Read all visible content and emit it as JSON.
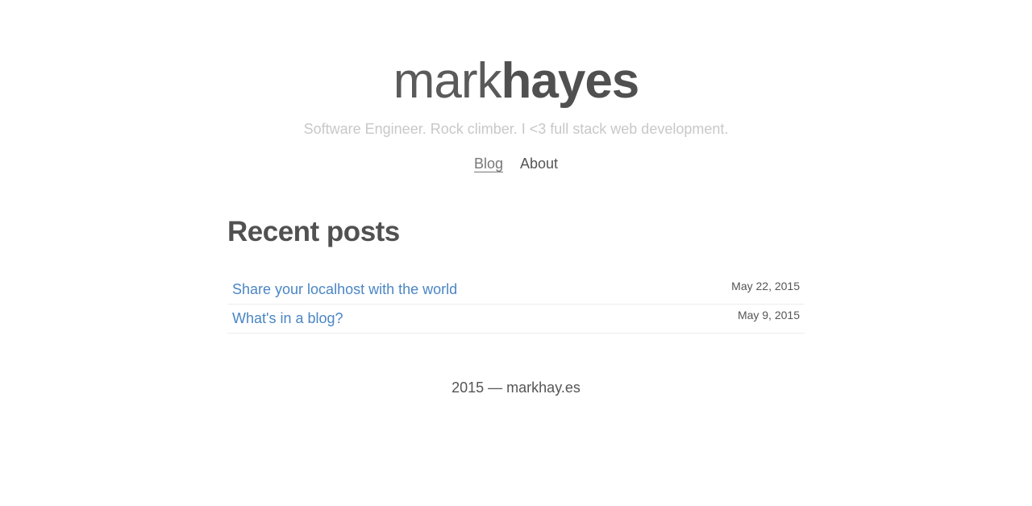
{
  "header": {
    "logo_light": "mark",
    "logo_bold": "hayes",
    "tagline": "Software Engineer. Rock climber. I <3 full stack web development."
  },
  "nav": {
    "items": [
      {
        "label": "Blog",
        "active": true
      },
      {
        "label": "About",
        "active": false
      }
    ]
  },
  "main": {
    "title": "Recent posts",
    "posts": [
      {
        "title": "Share your localhost with the world",
        "date": "May 22, 2015"
      },
      {
        "title": "What's in a blog?",
        "date": "May 9, 2015"
      }
    ]
  },
  "footer": {
    "text": "2015 — markhay.es"
  },
  "colors": {
    "link": "#4a86c5",
    "text": "#555555",
    "tagline": "#c8c8c8",
    "divider": "#eeeeee"
  }
}
